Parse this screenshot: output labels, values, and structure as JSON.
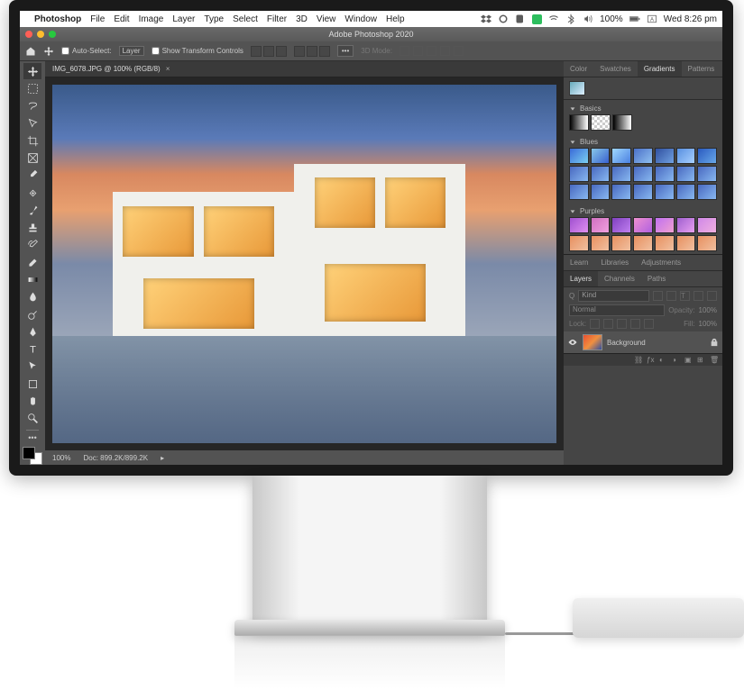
{
  "menubar": {
    "app": "Photoshop",
    "items": [
      "File",
      "Edit",
      "Image",
      "Layer",
      "Type",
      "Select",
      "Filter",
      "3D",
      "View",
      "Window",
      "Help"
    ],
    "battery": "100%",
    "clock": "Wed 8:26 pm"
  },
  "window": {
    "title": "Adobe Photoshop 2020"
  },
  "optionsbar": {
    "auto_select_label": "Auto-Select:",
    "auto_select_value": "Layer",
    "show_tc_label": "Show Transform Controls",
    "mode_label": "3D Mode:"
  },
  "document": {
    "tab_label": "IMG_6078.JPG @ 100% (RGB/8)"
  },
  "status": {
    "zoom": "100%",
    "doc_info": "Doc: 899.2K/899.2K"
  },
  "panels": {
    "top_tabs": [
      "Color",
      "Swatches",
      "Gradients",
      "Patterns"
    ],
    "top_active": "Gradients",
    "groups": {
      "basics": "Basics",
      "blues": "Blues",
      "purples": "Purples"
    },
    "mid_tabs": [
      "Learn",
      "Libraries",
      "Adjustments"
    ],
    "layer_tabs": [
      "Layers",
      "Channels",
      "Paths"
    ],
    "layer_active": "Layers",
    "kind_label": "Kind",
    "blend_mode": "Normal",
    "opacity_label": "Opacity:",
    "opacity_value": "100%",
    "lock_label": "Lock:",
    "fill_label": "Fill:",
    "fill_value": "100%",
    "bg_layer": "Background"
  }
}
